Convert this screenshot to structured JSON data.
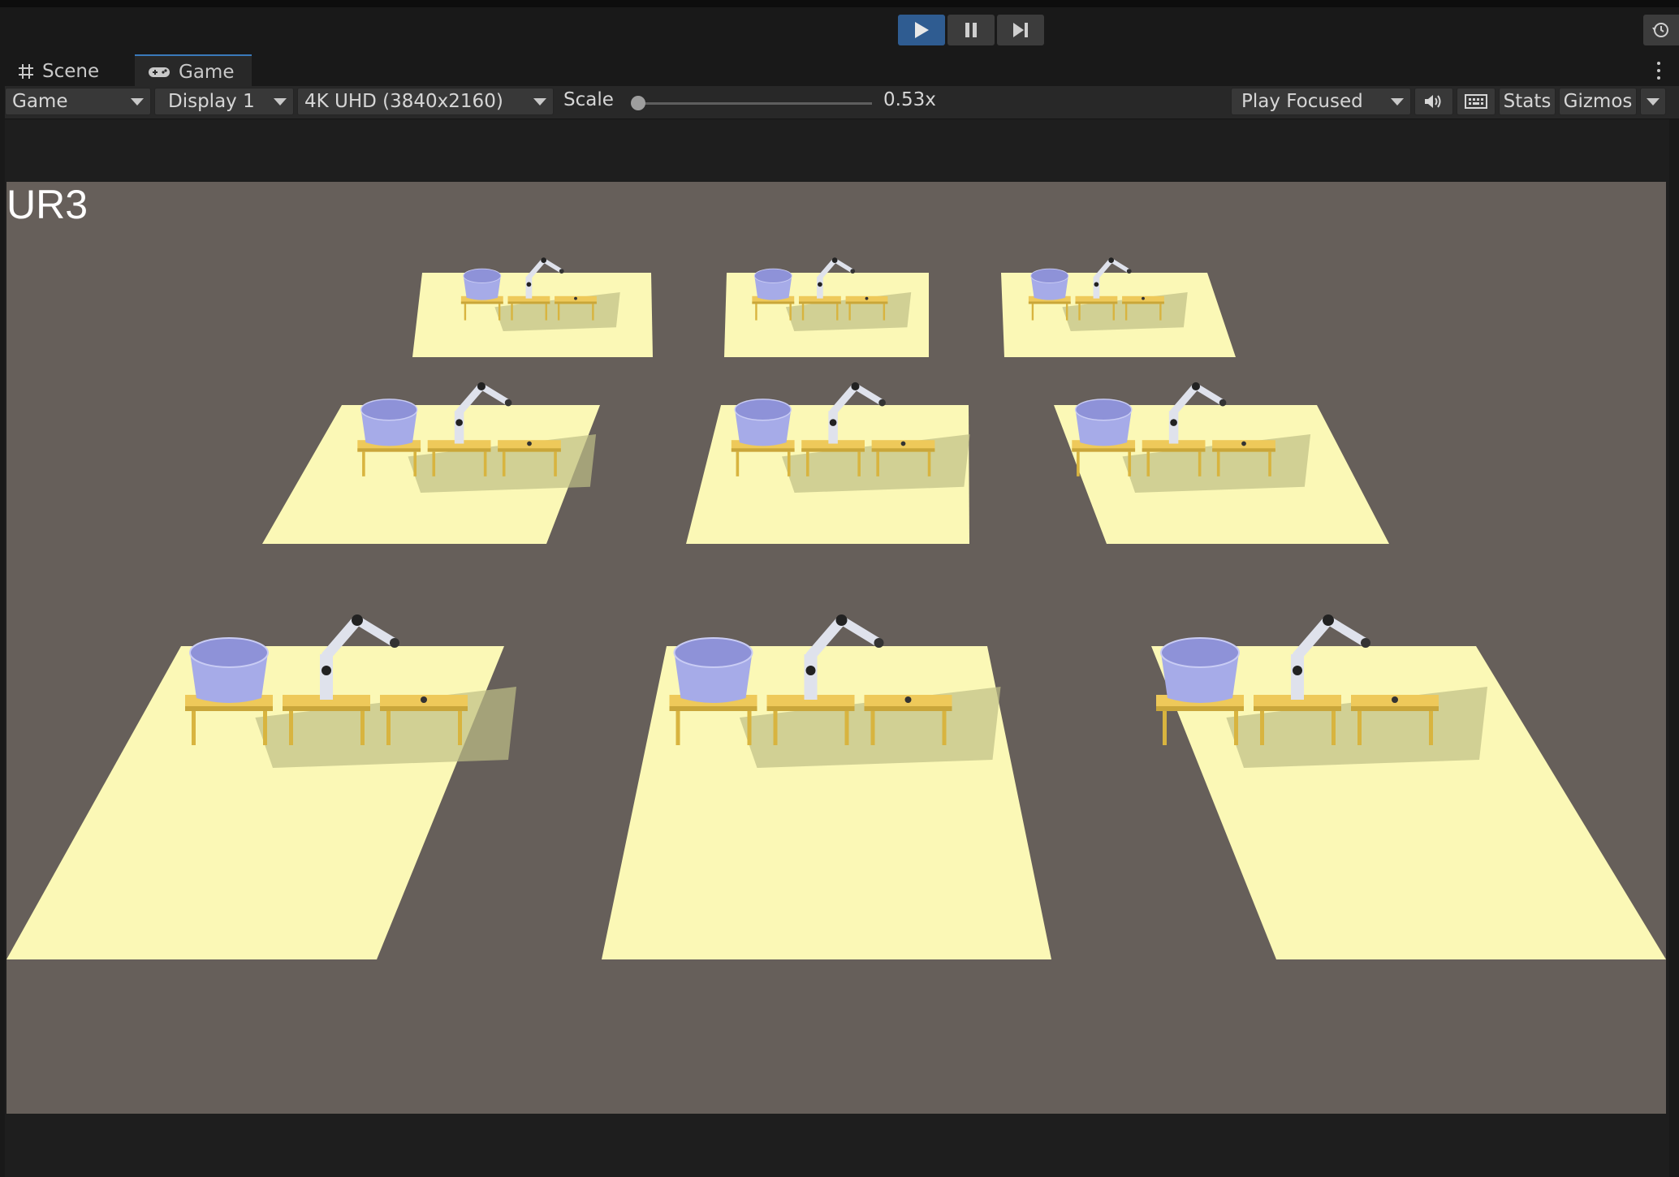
{
  "toolbar_top": {
    "play": "play",
    "pause": "pause",
    "step": "step"
  },
  "tabs": [
    {
      "label": "Scene",
      "icon": "grid-icon"
    },
    {
      "label": "Game",
      "icon": "gamepad-icon"
    }
  ],
  "game_toolbar": {
    "mode": "Game",
    "display": "Display 1",
    "resolution": "4K UHD (3840x2160)",
    "scale_label": "Scale",
    "scale_value": "0.53x",
    "scale_level": 0.0,
    "focus": "Play Focused",
    "stats": "Stats",
    "gizmos": "Gizmos"
  },
  "viewport": {
    "overlay_text": "UR3",
    "colors": {
      "background": "#665f5a",
      "platform": "#fbf8b6",
      "table": "#eec95a",
      "bowl": "#a6abe8",
      "robot": "#dfe2ec"
    },
    "environment_count": 9
  },
  "colors": {
    "accent": "#2f5c91",
    "panel": "#282828"
  }
}
